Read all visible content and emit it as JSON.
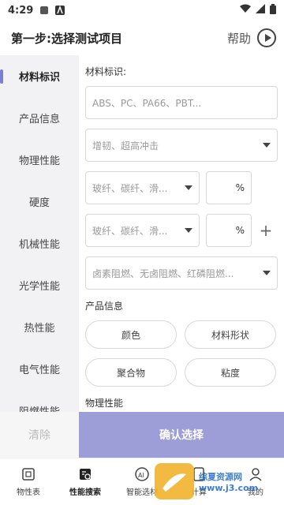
{
  "status_bar": {
    "time": "4:29"
  },
  "header": {
    "title": "第一步:选择测试项目",
    "help_label": "帮助"
  },
  "sidebar": {
    "items": [
      {
        "label": "材料标识"
      },
      {
        "label": "产品信息"
      },
      {
        "label": "物理性能"
      },
      {
        "label": "硬度"
      },
      {
        "label": "机械性能"
      },
      {
        "label": "光学性能"
      },
      {
        "label": "热性能"
      },
      {
        "label": "电气性能"
      },
      {
        "label": "阻燃性能"
      }
    ]
  },
  "material_id": {
    "section_title": "材料标识:",
    "polymer_placeholder": "ABS、PC、PA66、PBT...",
    "modifier_placeholder": "增韧、超高冲击",
    "filler1_placeholder": "玻纤、碳纤、滑...",
    "filler1_pct_unit": "%",
    "filler2_placeholder": "玻纤、碳纤、滑...",
    "filler2_pct_unit": "%",
    "flame_retardant_placeholder": "卤素阻燃、无卤阻燃、红磷阻燃..."
  },
  "product_info": {
    "section_title": "产品信息",
    "chips": [
      "颜色",
      "材料形状",
      "聚合物",
      "粘度"
    ]
  },
  "physical": {
    "section_title": "物理性能"
  },
  "actions": {
    "clear_label": "清除",
    "confirm_label": "确认选择"
  },
  "tabbar": {
    "tabs": [
      {
        "label": "物性表"
      },
      {
        "label": "性能搜索"
      },
      {
        "label": "智能选材"
      },
      {
        "label": "计算"
      },
      {
        "label": "我的"
      }
    ]
  },
  "watermark": {
    "text": "综夏资源网 www.j3.com"
  },
  "colors": {
    "accent": "#9d9ed8",
    "active_indicator": "#7b7fcf",
    "watermark_orange": "#f2b32e",
    "watermark_blue": "#2a71c7"
  }
}
